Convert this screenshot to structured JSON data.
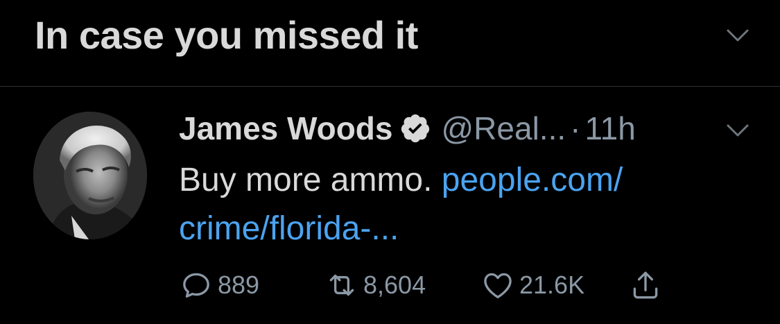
{
  "section": {
    "title": "In case you missed it",
    "collapse_icon": "chevron-down-icon"
  },
  "tweet": {
    "author_name": "James Woods",
    "verified_icon": "verified-badge-icon",
    "handle": "@Real...",
    "separator": "·",
    "time": "11h",
    "menu_icon": "chevron-down-icon",
    "text": "Buy more ammo.  ",
    "link_text": "people.com/crime/florida-...",
    "link_line1": "people.com/",
    "link_line2": "crime/florida-...",
    "stats": {
      "replies": "889",
      "retweets": "8,604",
      "likes": "21.6K"
    }
  },
  "colors": {
    "background": "#000000",
    "text_primary": "#d9d9d9",
    "text_secondary": "#8b98a5",
    "link": "#4ba3f0",
    "divider": "#2f3336"
  }
}
